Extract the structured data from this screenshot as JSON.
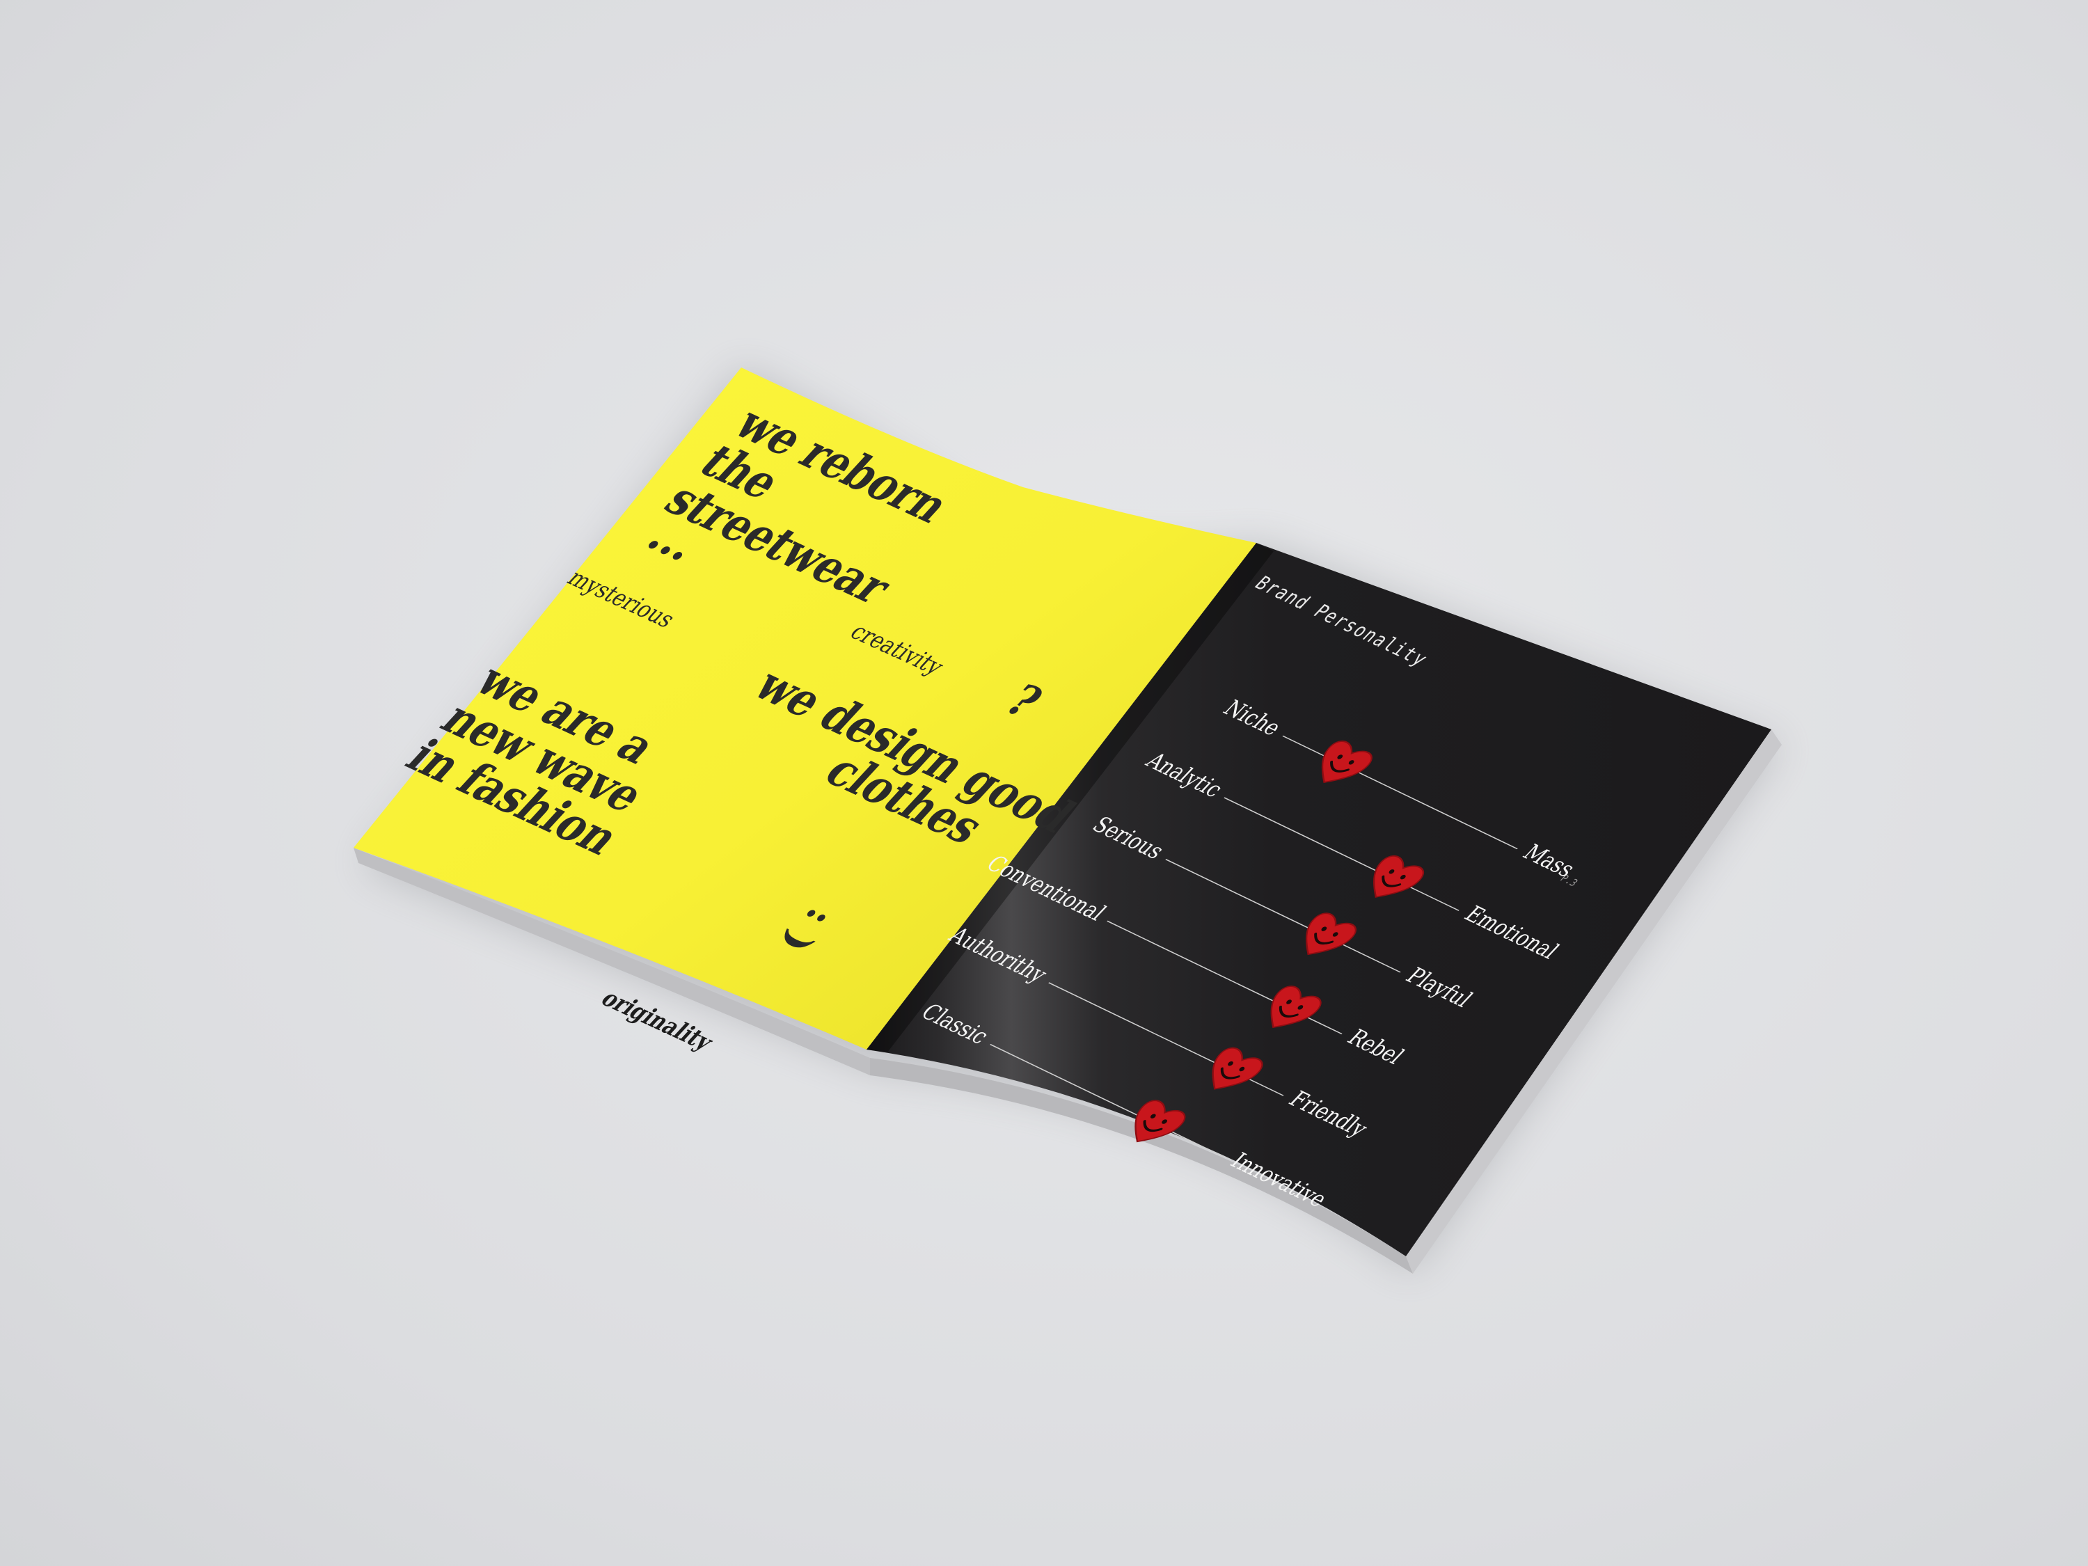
{
  "left_page": {
    "background": "#f9f33a",
    "headline_1": "we reborn the streetwear",
    "ellipsis": "...",
    "word_creativity": "creativity",
    "question_mark": "?",
    "word_mysterious": "mysterious",
    "headline_2_line1": "we design good",
    "headline_2_line2": "clothes",
    "headline_3": "we are a new wave in fashion",
    "smiley": ": )",
    "word_originality": "originality"
  },
  "right_page": {
    "background": "#1d1c1e",
    "title": "Brand Personality",
    "page_number": "P.3",
    "heart_color": "#c8161c",
    "scales": [
      {
        "left": "Niche",
        "right": "Mass",
        "value": 0.25
      },
      {
        "left": "Analytic",
        "right": "Emotional",
        "value": 0.72
      },
      {
        "left": "Serious",
        "right": "Playful",
        "value": 0.68
      },
      {
        "left": "Conventional",
        "right": "Rebel",
        "value": 0.78
      },
      {
        "left": "Authorithy",
        "right": "Friendly",
        "value": 0.78
      },
      {
        "left": "Classic",
        "right": "Innovative",
        "value": 0.7
      }
    ]
  }
}
